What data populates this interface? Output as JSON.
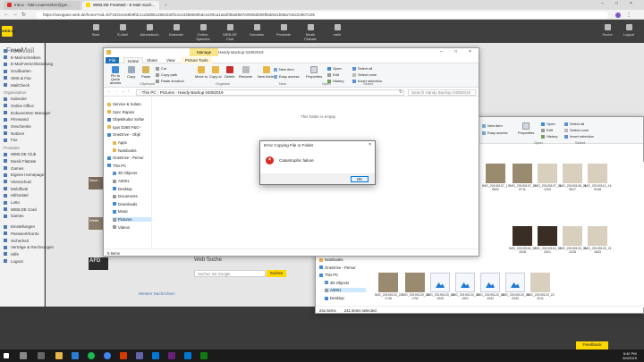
{
  "chrome": {
    "tabs": [
      {
        "label": "Inbox - fabio.maierseher@gm..."
      },
      {
        "label": "WEB.DE FreeMail - E-Mail mach..."
      }
    ],
    "new_tab": "+",
    "url": "https://navigator.web.de/home?sid=fd719316169b9fdc1cd3d8512863330f13144358590bdce229ca1a62fd6a8887e0506d006f9ab521b58a7a0222907105"
  },
  "webde": {
    "logo": "WEB.DE",
    "freemail_title": "FreeMail",
    "top_nav": [
      "Start",
      "E-Mail",
      "Adressbuch",
      "Kalender",
      "Online-Speicher",
      "WEB.DE Club",
      "Domains",
      "Produkte",
      "Musik Flatrate",
      "mehr"
    ],
    "top_right": [
      "Suche",
      "Logout"
    ],
    "sidebar": {
      "mail_items": [
        "E-Mail",
        "E-Mail schreiben",
        "E-Mail-Verschlüsselung",
        "Grußkarten",
        "SMS & Fax",
        "MailCheck"
      ],
      "org_heading": "Organisation",
      "org_items": [
        "Kalender",
        "Online Office",
        "Dokumenten Manager",
        "Pinnwand",
        "Geschenke",
        "Notizen",
        "Fax"
      ],
      "prod_heading": "Produkte",
      "prod_items": [
        "WEB.DE Club",
        "Musik Flatrate",
        "Games",
        "Eigene Homepage",
        "Virenschutz",
        "Mobilfunk",
        "Hilfsmittel",
        "Lotto",
        "WEB.DE Card",
        "Games"
      ],
      "footer_items": [
        "Einstellungen",
        "Passwort/Konto",
        "Sicherheit",
        "Verträge & Rechnungen",
        "Hilfe",
        "Logout"
      ]
    },
    "web_suche": "Web Suche",
    "search_placeholder": "Suchen mit Google",
    "search_button": "Suchen",
    "weitere_nachrichten": "Weitere Nachrichten",
    "side_labels": [
      "Neue",
      "Wette",
      "AFD"
    ],
    "feedback": "Feedback"
  },
  "explorer_main": {
    "title": "Handy Backup 04082019",
    "manage_tab": "Manage",
    "ribbon_tabs": [
      "File",
      "Home",
      "Share",
      "View",
      "Picture Tools"
    ],
    "clipboard": {
      "pin": "Pin to Quick access",
      "copy": "Copy",
      "paste": "Paste",
      "cut": "Cut",
      "copy_path": "Copy path",
      "paste_shortcut": "Paste shortcut",
      "label": "Clipboard"
    },
    "organize": {
      "move_to": "Move to",
      "copy_to": "Copy to",
      "delete": "Delete",
      "rename": "Rename",
      "label": "Organize"
    },
    "new_group": {
      "new_folder": "New folder",
      "new_item": "New item",
      "easy_access": "Easy access",
      "label": "New"
    },
    "open_group": {
      "properties": "Properties",
      "open": "Open",
      "edit": "Edit",
      "history": "History",
      "label": "Open"
    },
    "select_group": {
      "select_all": "Select all",
      "select_none": "Select none",
      "invert": "Invert selection",
      "label": "Select"
    },
    "breadcrumb": [
      "This PC",
      "Pictures",
      "Handy Backup 04082019"
    ],
    "search_placeholder": "Search Handy Backup 04082019",
    "empty_text": "This folder is empty.",
    "nav_items": [
      "Service & Soluto",
      "Sync Rapios",
      "Objektkultur Softw",
      "Igus D365 F&O -",
      "OneDrive - Objk",
      "Apps",
      "Notebooks",
      "OneDrive - Persor",
      "This PC",
      "3D Objects",
      "A0001",
      "Desktop",
      "Documents",
      "Downloads",
      "Music",
      "Pictures",
      "Videos"
    ],
    "status": "0 items"
  },
  "explorer_back": {
    "ribbon": {
      "new_item": "New item",
      "easy_access": "Easy access",
      "open": "Open",
      "edit": "Edit",
      "history": "History",
      "properties": "Properties",
      "select_all": "Select all",
      "select_none": "Select none",
      "invert": "Invert selection",
      "open_label": "Open",
      "select_label": "Select"
    },
    "nav_items": [
      "Notebooks",
      "OneDrive - Persor",
      "This PC",
      "3D Objects",
      "A0001",
      "Desktop"
    ],
    "status_count": "241 items",
    "status_selected": "241 items selected",
    "captions": [
      "IMG_20190107_17 5602",
      "IMG_20190107_17 5711",
      "IMG_20190107_21 1253",
      "IMG_20190108_21 0617",
      "IMG_20190110_14 5158",
      "IMG_20190116_17 1528",
      "IMG_20190116_17 2521",
      "IMG_20190120_21 1228",
      "IMG_20190120_21 1633",
      "IMG_20190120_22 1745",
      "IMG_20190120_22 1752",
      "IMG_20190120_22 1940",
      "IMG_20190120_22 1901",
      "IMG_20190120_22 1942",
      "IMG_20190120_22 2043",
      "IMG_20190120_22 2011"
    ]
  },
  "dialog": {
    "title": "Error Copying File or Folder",
    "close": "×",
    "message": "Catastrophic failure",
    "ok": "OK",
    "error_icon": "×"
  },
  "taskbar": {
    "time": "5:42 PM",
    "date": "8/4/2019"
  },
  "colors": {
    "webde_yellow": "#ffd800",
    "explorer_blue": "#1f6fb6",
    "error_red": "#d9281e",
    "manage_tab": "#f7e58a"
  }
}
